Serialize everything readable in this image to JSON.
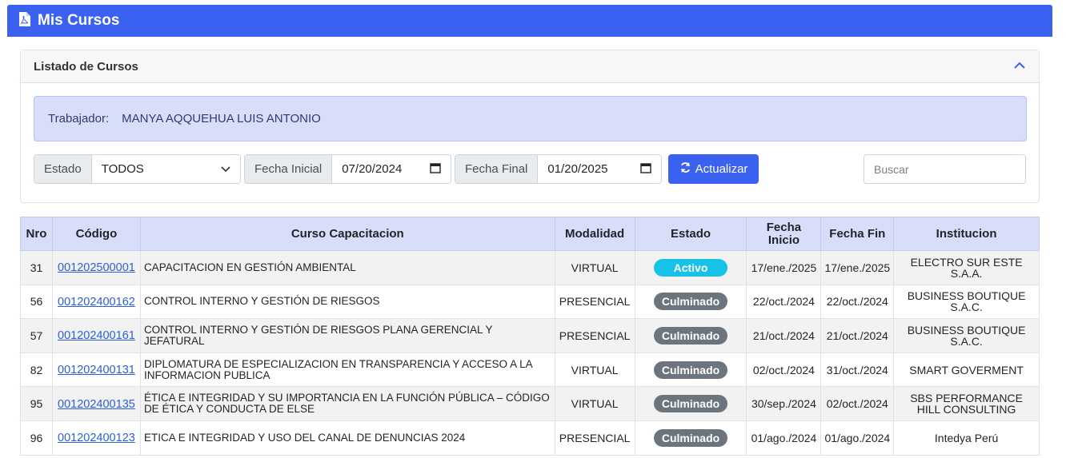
{
  "header": {
    "title": "Mis Cursos"
  },
  "card": {
    "title": "Listado de Cursos"
  },
  "worker": {
    "label": "Trabajador:",
    "name": "MANYA AQQUEHUA LUIS ANTONIO"
  },
  "filters": {
    "estado_label": "Estado",
    "estado_value": "TODOS",
    "fecha_inicial_label": "Fecha Inicial",
    "fecha_inicial_value": "07/20/2024",
    "fecha_final_label": "Fecha Final",
    "fecha_final_value": "01/20/2025",
    "refresh_label": "Actualizar",
    "search_placeholder": "Buscar"
  },
  "colors": {
    "primary": "#3a61ef",
    "activo": "#17c1e8",
    "culminado": "#6c757d"
  },
  "table": {
    "headers": [
      "Nro",
      "Código",
      "Curso Capacitacion",
      "Modalidad",
      "Estado",
      "Fecha Inicio",
      "Fecha Fin",
      "Institucion"
    ],
    "rows": [
      {
        "nro": "31",
        "codigo": "001202500001",
        "curso": "CAPACITACION EN GESTIÓN AMBIENTAL",
        "modalidad": "VIRTUAL",
        "estado": "Activo",
        "inicio": "17/ene./2025",
        "fin": "17/ene./2025",
        "institucion": "ELECTRO SUR ESTE S.A.A."
      },
      {
        "nro": "56",
        "codigo": "001202400162",
        "curso": "CONTROL INTERNO Y GESTIÓN DE RIESGOS",
        "modalidad": "PRESENCIAL",
        "estado": "Culminado",
        "inicio": "22/oct./2024",
        "fin": "22/oct./2024",
        "institucion": "BUSINESS BOUTIQUE S.A.C."
      },
      {
        "nro": "57",
        "codigo": "001202400161",
        "curso": "CONTROL INTERNO Y GESTIÓN DE RIESGOS PLANA GERENCIAL Y JEFATURAL",
        "modalidad": "PRESENCIAL",
        "estado": "Culminado",
        "inicio": "21/oct./2024",
        "fin": "21/oct./2024",
        "institucion": "BUSINESS BOUTIQUE S.A.C."
      },
      {
        "nro": "82",
        "codigo": "001202400131",
        "curso": "DIPLOMATURA DE ESPECIALIZACION EN TRANSPARENCIA Y ACCESO A LA INFORMACION PUBLICA",
        "modalidad": "VIRTUAL",
        "estado": "Culminado",
        "inicio": "02/oct./2024",
        "fin": "31/oct./2024",
        "institucion": "SMART GOVERMENT"
      },
      {
        "nro": "95",
        "codigo": "001202400135",
        "curso": "ÉTICA E INTEGRIDAD Y SU IMPORTANCIA EN LA FUNCIÓN PÚBLICA – CÓDIGO DE ÉTICA Y CONDUCTA DE ELSE",
        "modalidad": "VIRTUAL",
        "estado": "Culminado",
        "inicio": "30/sep./2024",
        "fin": "02/oct./2024",
        "institucion": "SBS PERFORMANCE HILL CONSULTING"
      },
      {
        "nro": "96",
        "codigo": "001202400123",
        "curso": "ETICA E INTEGRIDAD Y USO DEL CANAL DE DENUNCIAS 2024",
        "modalidad": "PRESENCIAL",
        "estado": "Culminado",
        "inicio": "01/ago./2024",
        "fin": "01/ago./2024",
        "institucion": "Intedya Perú"
      }
    ]
  }
}
